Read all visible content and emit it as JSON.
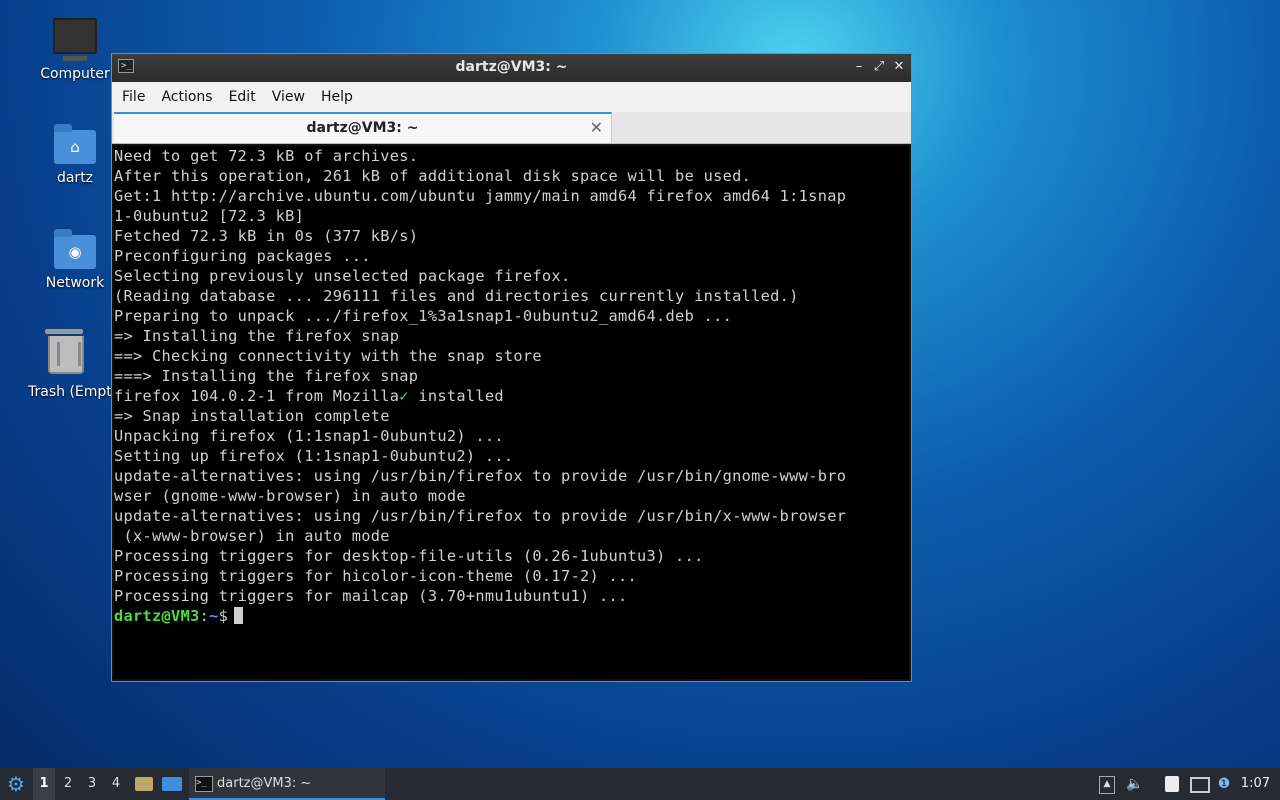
{
  "desktop": {
    "icons": [
      {
        "label": "Computer",
        "icon": "monitor-icon"
      },
      {
        "label": "dartz",
        "icon": "home-folder-icon"
      },
      {
        "label": "Network",
        "icon": "network-folder-icon"
      },
      {
        "label": "Trash (Empt",
        "icon": "trash-icon"
      }
    ]
  },
  "window": {
    "title": "dartz@VM3: ~",
    "menu": [
      "File",
      "Actions",
      "Edit",
      "View",
      "Help"
    ],
    "tab_label": "dartz@VM3: ~",
    "terminal_lines": [
      "Need to get 72.3 kB of archives.",
      "After this operation, 261 kB of additional disk space will be used.",
      "Get:1 http://archive.ubuntu.com/ubuntu jammy/main amd64 firefox amd64 1:1snap",
      "1-0ubuntu2 [72.3 kB]",
      "Fetched 72.3 kB in 0s (377 kB/s)",
      "Preconfiguring packages ...",
      "Selecting previously unselected package firefox.",
      "(Reading database ... 296111 files and directories currently installed.)",
      "Preparing to unpack .../firefox_1%3a1snap1-0ubuntu2_amd64.deb ...",
      "=> Installing the firefox snap",
      "==> Checking connectivity with the snap store",
      "===> Installing the firefox snap",
      "firefox 104.0.2-1 from Mozilla✓ installed",
      "=> Snap installation complete",
      "Unpacking firefox (1:1snap1-0ubuntu2) ...",
      "Setting up firefox (1:1snap1-0ubuntu2) ...",
      "update-alternatives: using /usr/bin/firefox to provide /usr/bin/gnome-www-bro",
      "wser (gnome-www-browser) in auto mode",
      "update-alternatives: using /usr/bin/firefox to provide /usr/bin/x-www-browser",
      " (x-www-browser) in auto mode",
      "Processing triggers for desktop-file-utils (0.26-1ubuntu3) ...",
      "Processing triggers for hicolor-icon-theme (0.17-2) ...",
      "Processing triggers for mailcap (3.70+nmu1ubuntu1) ..."
    ],
    "prompt": {
      "user_host": "dartz@VM3",
      "sep": ":",
      "path": "~",
      "symbol": "$"
    }
  },
  "taskbar": {
    "workspaces": [
      "1",
      "2",
      "3",
      "4"
    ],
    "active_workspace": "1",
    "task_label": "dartz@VM3: ~",
    "clock": "1:07",
    "accent": "#3d8ee0"
  }
}
